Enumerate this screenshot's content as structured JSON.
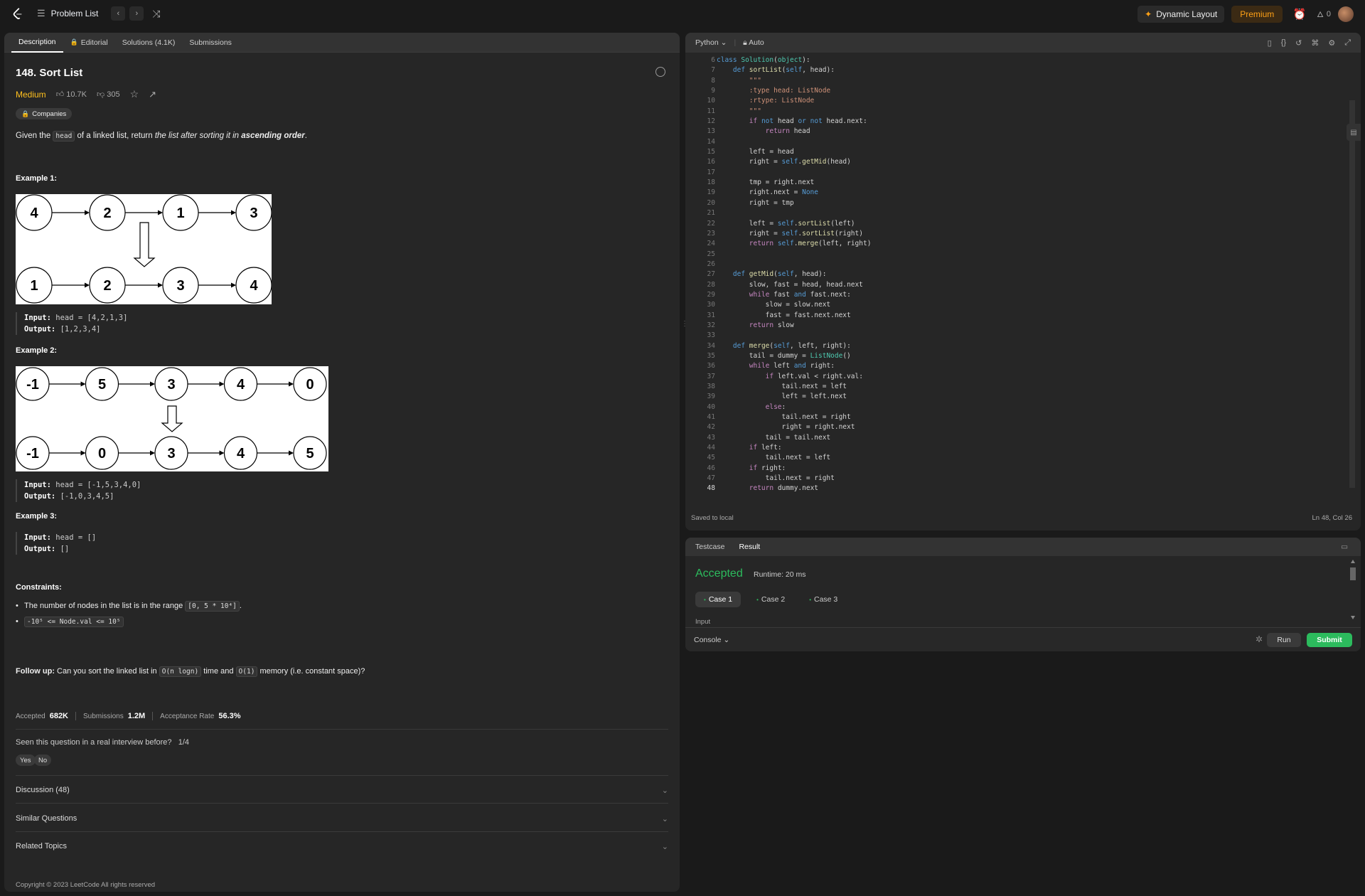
{
  "nav": {
    "title": "Problem List",
    "dynamic_layout": "Dynamic Layout",
    "premium": "Premium",
    "streak": "0"
  },
  "tabs": [
    "Description",
    "Editorial",
    "Solutions (4.1K)",
    "Submissions"
  ],
  "problem": {
    "title": "148. Sort List",
    "difficulty": "Medium",
    "likes": "10.7K",
    "dislikes": "305",
    "companies": "Companies",
    "desc_pre": "Given the ",
    "desc_code": "head",
    "desc_mid": " of a linked list, return ",
    "desc_em": "the list after sorting it in ",
    "desc_strong": "ascending order",
    "desc_end": "."
  },
  "examples": [
    {
      "title": "Example 1:",
      "top": [
        "4",
        "2",
        "1",
        "3"
      ],
      "bottom": [
        "1",
        "2",
        "3",
        "4"
      ],
      "input_label": "Input:",
      "input": "head = [4,2,1,3]",
      "output_label": "Output:",
      "output": "[1,2,3,4]"
    },
    {
      "title": "Example 2:",
      "top": [
        "-1",
        "5",
        "3",
        "4",
        "0"
      ],
      "bottom": [
        "-1",
        "0",
        "3",
        "4",
        "5"
      ],
      "input_label": "Input:",
      "input": "head = [-1,5,3,4,0]",
      "output_label": "Output:",
      "output": "[-1,0,3,4,5]"
    },
    {
      "title": "Example 3:",
      "input_label": "Input:",
      "input": "head = []",
      "output_label": "Output:",
      "output": "[]"
    }
  ],
  "constraints": {
    "title": "Constraints:",
    "c1_pre": "The number of nodes in the list is in the range ",
    "c1_code": "[0, 5 * 10⁴]",
    "c1_end": ".",
    "c2_code": "-10⁵ <= Node.val <= 10⁵"
  },
  "followup": {
    "label": "Follow up:",
    "pre": " Can you sort the linked list in ",
    "code1": "O(n logn)",
    "mid": " time and ",
    "code2": "O(1)",
    "end": " memory (i.e. constant space)?"
  },
  "stats": {
    "accepted_label": "Accepted",
    "accepted": "682K",
    "submissions_label": "Submissions",
    "submissions": "1.2M",
    "rate_label": "Acceptance Rate",
    "rate": "56.3%"
  },
  "interview": {
    "question": "Seen this question in a real interview before?",
    "count": "1/4",
    "yes": "Yes",
    "no": "No"
  },
  "accordion": [
    "Discussion (48)",
    "Similar Questions",
    "Related Topics"
  ],
  "copyright": "Copyright © 2023 LeetCode All rights reserved",
  "editor": {
    "language": "Python",
    "mode": "Auto",
    "saved": "Saved to local",
    "position": "Ln 48, Col 26",
    "first_line": 6,
    "current_line": 48,
    "code": [
      "class Solution(object):",
      "    def sortList(self, head):",
      "        \"\"\"",
      "        :type head: ListNode",
      "        :rtype: ListNode",
      "        \"\"\"",
      "        if not head or not head.next:",
      "            return head",
      "",
      "        left = head",
      "        right = self.getMid(head)",
      "",
      "        tmp = right.next",
      "        right.next = None",
      "        right = tmp",
      "",
      "        left = self.sortList(left)",
      "        right = self.sortList(right)",
      "        return self.merge(left, right)",
      "",
      "",
      "    def getMid(self, head):",
      "        slow, fast = head, head.next",
      "        while fast and fast.next:",
      "            slow = slow.next",
      "            fast = fast.next.next",
      "        return slow",
      "",
      "    def merge(self, left, right):",
      "        tail = dummy = ListNode()",
      "        while left and right:",
      "            if left.val < right.val:",
      "                tail.next = left",
      "                left = left.next",
      "            else:",
      "                tail.next = right",
      "                right = right.next",
      "            tail = tail.next",
      "        if left:",
      "            tail.next = left",
      "        if right:",
      "            tail.next = right",
      "        return dummy.next"
    ]
  },
  "result": {
    "tabs": [
      "Testcase",
      "Result"
    ],
    "status": "Accepted",
    "runtime": "Runtime: 20 ms",
    "cases": [
      "Case 1",
      "Case 2",
      "Case 3"
    ],
    "input_label": "Input",
    "console": "Console",
    "run": "Run",
    "submit": "Submit"
  }
}
